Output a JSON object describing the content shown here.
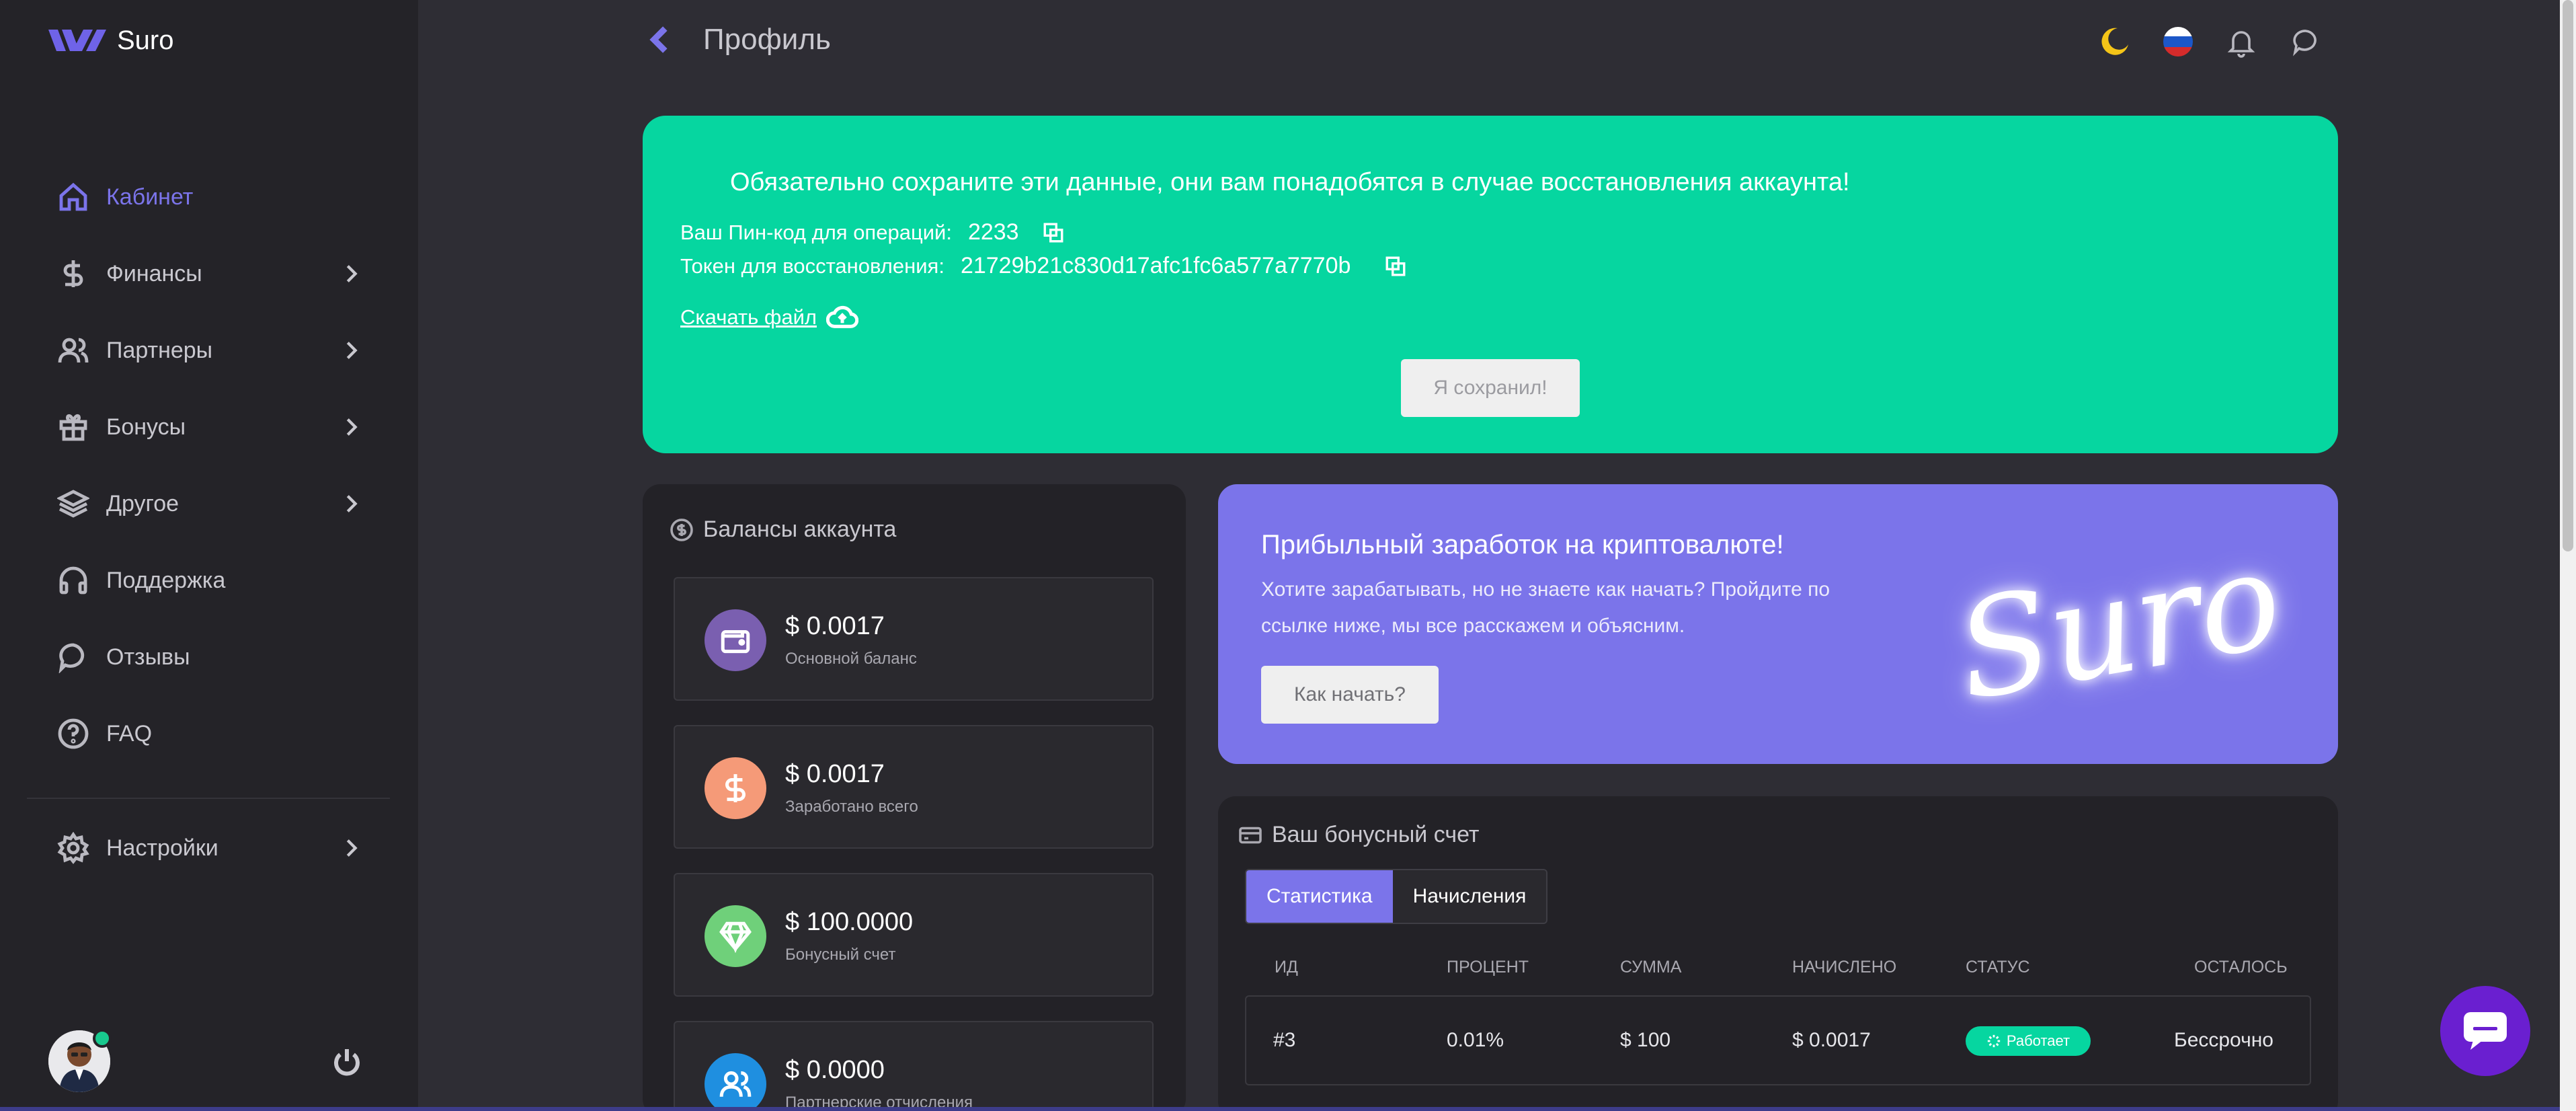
{
  "app": {
    "brand": "Suro",
    "accent": "#7b74ea",
    "success": "#06d6a0"
  },
  "header": {
    "title": "Профиль",
    "icons": [
      "moon-icon",
      "russia-flag-icon",
      "bell-icon",
      "chat-icon"
    ]
  },
  "sidebar": {
    "items": [
      {
        "label": "Кабинет",
        "icon": "home-icon",
        "active": true,
        "submenu": false
      },
      {
        "label": "Финансы",
        "icon": "dollar-icon",
        "active": false,
        "submenu": true
      },
      {
        "label": "Партнеры",
        "icon": "users-icon",
        "active": false,
        "submenu": true
      },
      {
        "label": "Бонусы",
        "icon": "gift-icon",
        "active": false,
        "submenu": true
      },
      {
        "label": "Другое",
        "icon": "layers-icon",
        "active": false,
        "submenu": true
      },
      {
        "label": "Поддержка",
        "icon": "headphones-icon",
        "active": false,
        "submenu": false
      },
      {
        "label": "Отзывы",
        "icon": "comment-icon",
        "active": false,
        "submenu": false
      },
      {
        "label": "FAQ",
        "icon": "question-icon",
        "active": false,
        "submenu": false
      }
    ],
    "settings": {
      "label": "Настройки",
      "icon": "gear-icon"
    }
  },
  "alert": {
    "title": "Обязательно сохраните эти данные, они вам понадобятся в случае восстановления аккаунта!",
    "pin_label": "Ваш Пин-код для операций:",
    "pin_value": "2233",
    "token_label": "Токен для восстановления:",
    "token_value": "21729b21c830d17afc1fc6a577a7770b",
    "download_label": "Скачать файл",
    "saved_button": "Я сохранил!"
  },
  "balances": {
    "title": "Балансы аккаунта",
    "cards": [
      {
        "amount": "$ 0.0017",
        "label": "Основной баланс",
        "color": "#7a5fb0",
        "icon": "wallet-icon"
      },
      {
        "amount": "$ 0.0017",
        "label": "Заработано всего",
        "color": "#f59a78",
        "icon": "dollar-icon"
      },
      {
        "amount": "$ 100.0000",
        "label": "Бонусный счет",
        "color": "#6fd07a",
        "icon": "diamond-icon"
      },
      {
        "amount": "$ 0.0000",
        "label": "Партнерские отчисления",
        "color": "#1f8fe0",
        "icon": "users-icon"
      }
    ]
  },
  "promo": {
    "title": "Прибыльный заработок на криптовалюте!",
    "text": "Хотите зарабатывать, но не знаете как начать? Пройдите по ссылке ниже, мы все расскажем и объясним.",
    "button": "Как начать?",
    "logo_text": "Suro"
  },
  "bonus": {
    "title": "Ваш бонусный счет",
    "tabs": [
      "Статистика",
      "Начисления"
    ],
    "columns": [
      "ИД",
      "ПРОЦЕНТ",
      "СУММА",
      "НАЧИСЛЕНО",
      "СТАТУС",
      "ОСТАЛОСЬ"
    ],
    "rows": [
      {
        "id": "#3",
        "percent": "0.01%",
        "sum": "$ 100",
        "accrued": "$ 0.0017",
        "status": "Работает",
        "remaining": "Бессрочно"
      }
    ]
  }
}
